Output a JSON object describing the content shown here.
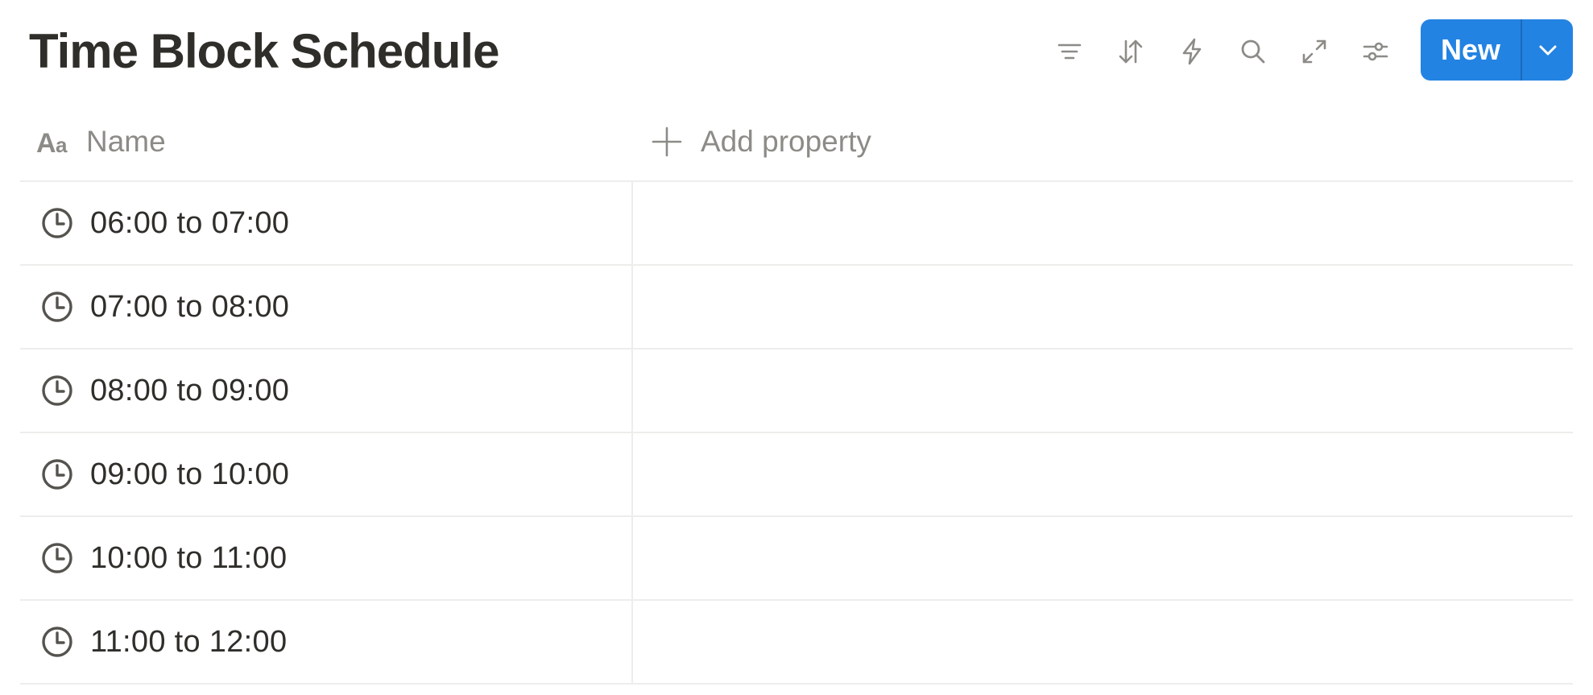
{
  "page": {
    "title": "Time Block Schedule"
  },
  "toolbar": {
    "icons": [
      "filter-icon",
      "sort-icon",
      "automation-icon",
      "search-icon",
      "expand-icon",
      "settings-icon"
    ],
    "new_label": "New"
  },
  "table": {
    "columns": [
      {
        "label": "Name",
        "icon": "text-property-icon"
      },
      {
        "label": "Add property",
        "icon": "plus-icon"
      }
    ],
    "rows": [
      {
        "name": "06:00 to 07:00",
        "icon": "clock-icon"
      },
      {
        "name": "07:00 to 08:00",
        "icon": "clock-icon"
      },
      {
        "name": "08:00 to 09:00",
        "icon": "clock-icon"
      },
      {
        "name": "09:00 to 10:00",
        "icon": "clock-icon"
      },
      {
        "name": "10:00 to 11:00",
        "icon": "clock-icon"
      },
      {
        "name": "11:00 to 12:00",
        "icon": "clock-icon"
      }
    ]
  },
  "colors": {
    "accent": "#2383e2",
    "text": "#2f2e2a",
    "muted": "#8c8b87",
    "border": "#ededec",
    "icon": "#8c8b87"
  }
}
